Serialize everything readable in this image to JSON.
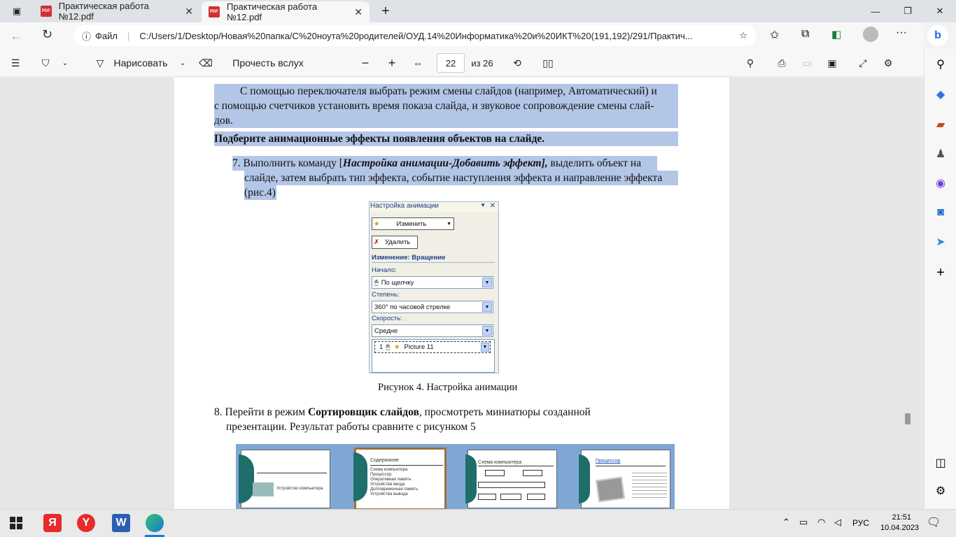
{
  "tabs": [
    {
      "label": "Практическая работа №12.pdf",
      "icon": "pdf-icon"
    },
    {
      "label": "Практическая работа №12.pdf",
      "icon": "pdf-icon"
    }
  ],
  "address": {
    "prefix": "Файл",
    "url": "C:/Users/1/Desktop/Новая%20папка/C%20ноута%20родителей/ОУД.14%20Информатика%20и%20ИКТ%20(191,192)/291/Практич..."
  },
  "toolbar": {
    "draw": "Нарисовать",
    "read_aloud": "Прочесть вслух",
    "page_value": "22",
    "page_total": "из 26"
  },
  "doc": {
    "p1": "С помощью переключателя выбрать режим смены слайдов (например, Автоматический) и",
    "p1b": "с помощью счетчиков установить время показа слайда, и звуковое сопровождение смены слай-",
    "p1c": "дов.",
    "bold_heading": "Подберите  анимационные эффекты появления объектов на слайде.",
    "step7_a": "7. Выполнить команду [",
    "step7_b": "Настройка анимации-Добавить эффект],",
    "step7_c": " выделить объект на",
    "step7_d": "слайде, затем выбрать тип эффекта, событие наступления эффекта и направление эффекта",
    "step7_e": "(рис.4)",
    "caption4": "Рисунок 4. Настройка анимации",
    "step8_a": "8. Перейти в режим ",
    "step8_b": "Сортировщик слайдов",
    "step8_c": ", просмотреть миниатюры созданной",
    "step8_d": "презентации. Результат работы сравните с рисунком 5"
  },
  "anim_panel": {
    "title": "Настройка анимации",
    "change": "Изменить",
    "delete": "Удалить",
    "section": "Изменение: Вращение",
    "start_label": "Начало:",
    "start_value": "По щелчку",
    "degree_label": "Степень:",
    "degree_value": "360° по часовой стрелке",
    "speed_label": "Скорость:",
    "speed_value": "Средне",
    "item_num": "1",
    "item_name": "Picture 11"
  },
  "slides": {
    "s1": "Устройство компьютера",
    "s2_title": "Содержание",
    "s2_items": [
      "Схема компьютера",
      "Процессор",
      "Оперативная память",
      "Устройства ввода",
      "Долговременная память",
      "Устройства вывода"
    ],
    "s3_title": "Схема компьютера",
    "s4_title": "Процессор"
  },
  "taskbar": {
    "lang": "РУС",
    "time": "21:51",
    "date": "10.04.2023"
  }
}
